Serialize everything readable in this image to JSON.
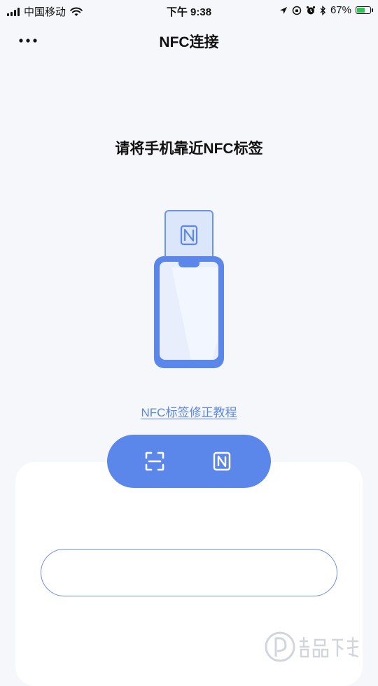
{
  "status_bar": {
    "carrier": "中国移动",
    "time": "下午 9:38",
    "battery_percent": "67%",
    "battery_level": 0.67,
    "icons": [
      "signal-icon",
      "wifi-icon",
      "location-icon",
      "orientation-lock-icon",
      "alarm-icon",
      "bluetooth-icon",
      "battery-icon"
    ]
  },
  "nav": {
    "more_icon": "more-dots-icon",
    "title": "NFC连接"
  },
  "main": {
    "prompt": "请将手机靠近NFC标签",
    "illustration_icons": [
      "nfc-tag-icon",
      "phone-icon"
    ],
    "fix_link": "NFC标签修正教程"
  },
  "mode_switch": {
    "options": [
      {
        "id": "scan",
        "icon": "scan-icon"
      },
      {
        "id": "nfc",
        "icon": "nfc-icon"
      }
    ]
  },
  "input": {
    "value": "",
    "placeholder": ""
  },
  "colors": {
    "accent": "#5b87ea",
    "link": "#5c86e6",
    "background": "#f6f7fb",
    "card": "#ffffff"
  }
}
